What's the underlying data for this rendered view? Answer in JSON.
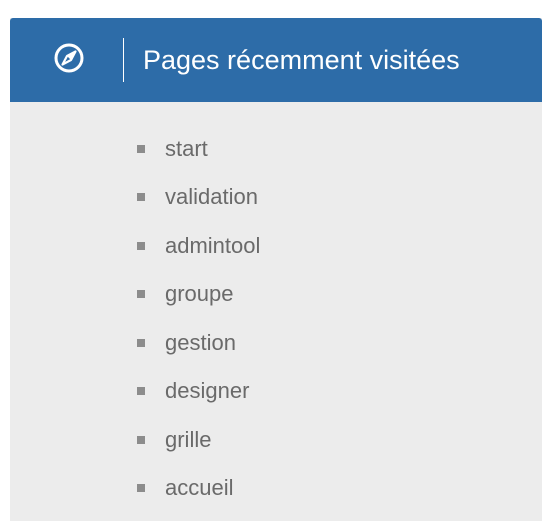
{
  "widget": {
    "title": "Pages récemment visitées",
    "icon": "compass-icon"
  },
  "pages": [
    {
      "label": "start"
    },
    {
      "label": "validation"
    },
    {
      "label": "admintool"
    },
    {
      "label": "groupe"
    },
    {
      "label": "gestion"
    },
    {
      "label": "designer"
    },
    {
      "label": "grille"
    },
    {
      "label": "accueil"
    }
  ],
  "colors": {
    "header": "#2d6ca8",
    "panel": "#ececec",
    "link_text": "#6a6a6a",
    "bullet": "#8c8c8c"
  }
}
